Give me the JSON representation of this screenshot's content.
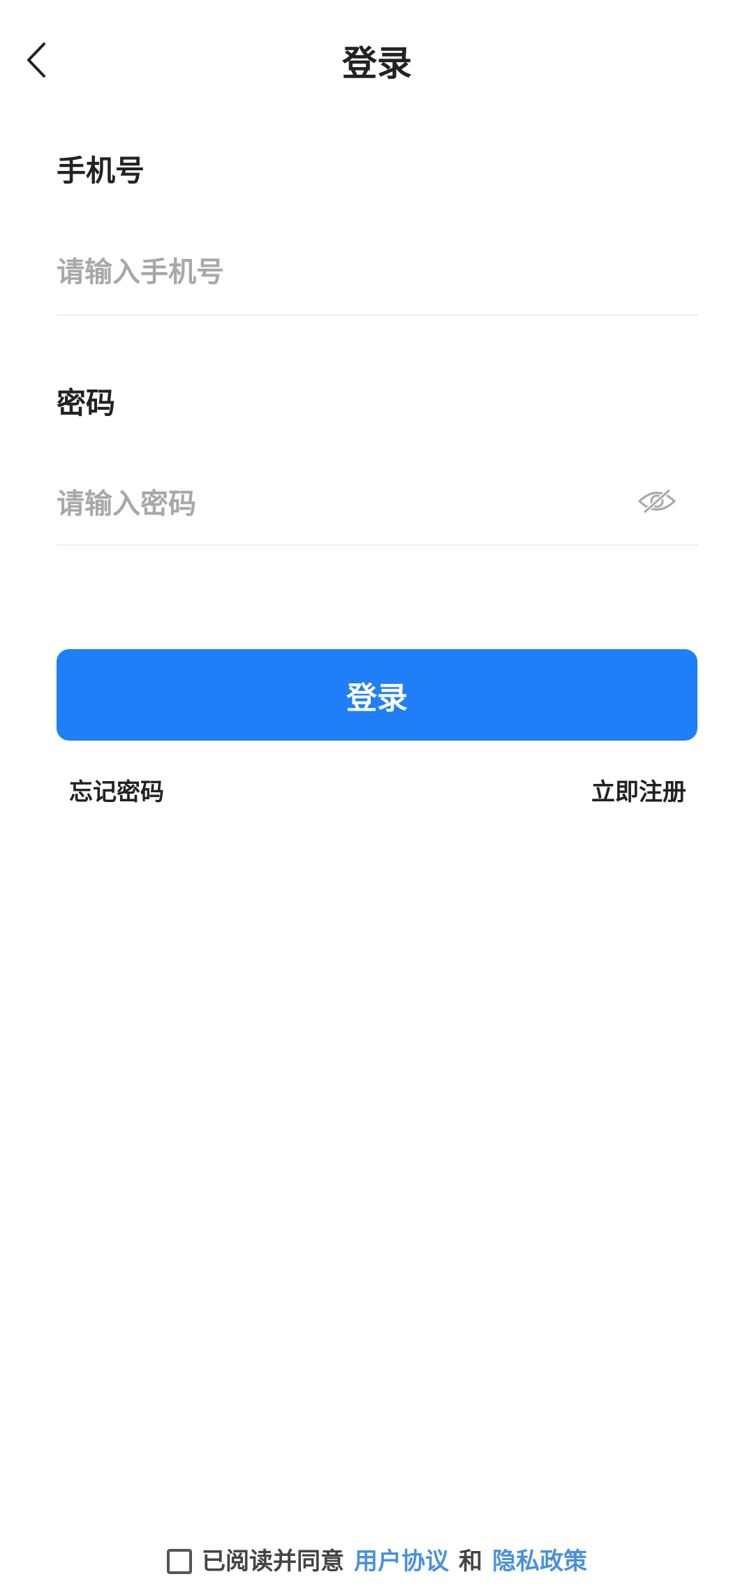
{
  "header": {
    "title": "登录",
    "back_icon": "chevron-left-icon"
  },
  "phone": {
    "label": "手机号",
    "placeholder": "请输入手机号",
    "value": ""
  },
  "password": {
    "label": "密码",
    "placeholder": "请输入密码",
    "value": "",
    "toggle_icon": "eye-hidden-icon"
  },
  "actions": {
    "login_label": "登录",
    "forgot_label": "忘记密码",
    "register_label": "立即注册"
  },
  "agreement": {
    "checked": false,
    "prefix": "已阅读并同意",
    "user_agreement": "用户协议",
    "and": "和",
    "privacy_policy": "隐私政策"
  },
  "colors": {
    "primary": "#1e7ff8",
    "link": "#4a90e2",
    "placeholder": "#a8a8a8",
    "text": "#222222",
    "divider": "#eeeeee"
  }
}
